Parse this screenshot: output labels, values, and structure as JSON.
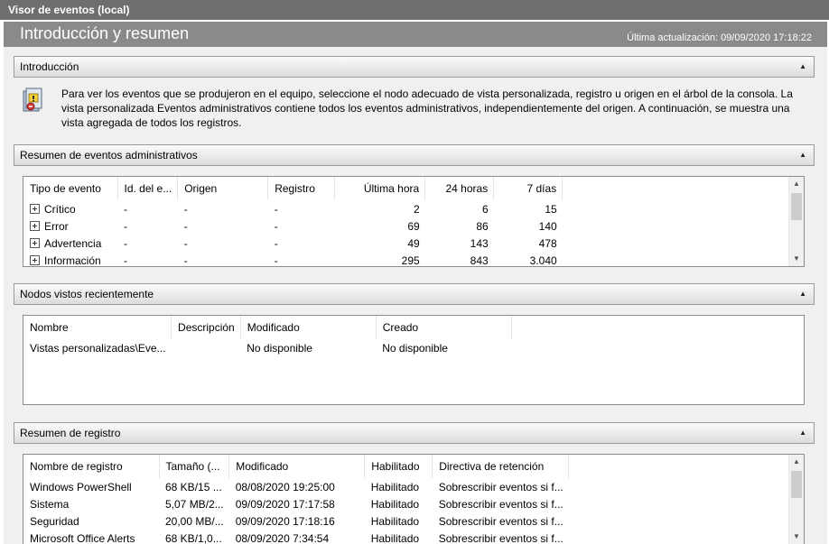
{
  "window_title": "Visor de eventos (local)",
  "page": {
    "title": "Introducción y resumen",
    "last_updated": "Última actualización: 09/09/2020 17:18:22"
  },
  "intro": {
    "header": "Introducción",
    "icon": "event-viewer-icon",
    "text": "Para ver los eventos que se produjeron en el equipo, seleccione el nodo adecuado de vista personalizada, registro u origen en el árbol de la consola. La vista personalizada Eventos administrativos contiene todos los eventos administrativos, independientemente del origen. A continuación, se muestra una vista agregada de todos los registros."
  },
  "admin_summary": {
    "header": "Resumen de eventos administrativos",
    "columns": [
      "Tipo de evento",
      "Id. del e...",
      "Origen",
      "Registro",
      "Última hora",
      "24 horas",
      "7 días"
    ],
    "rows": [
      [
        "Crítico",
        "-",
        "-",
        "-",
        "2",
        "6",
        "15"
      ],
      [
        "Error",
        "-",
        "-",
        "-",
        "69",
        "86",
        "140"
      ],
      [
        "Advertencia",
        "-",
        "-",
        "-",
        "49",
        "143",
        "478"
      ],
      [
        "Información",
        "-",
        "-",
        "-",
        "295",
        "843",
        "3.040"
      ]
    ]
  },
  "recent_nodes": {
    "header": "Nodos vistos recientemente",
    "columns": [
      "Nombre",
      "Descripción",
      "Modificado",
      "Creado"
    ],
    "rows": [
      [
        "Vistas personalizadas\\Eve...",
        "",
        "No disponible",
        "No disponible"
      ]
    ]
  },
  "log_summary": {
    "header": "Resumen de registro",
    "columns": [
      "Nombre de registro",
      "Tamaño (...",
      "Modificado",
      "Habilitado",
      "Directiva de retención"
    ],
    "rows": [
      [
        "Windows PowerShell",
        "68 KB/15 ...",
        "08/08/2020 19:25:00",
        "Habilitado",
        "Sobrescribir eventos si f..."
      ],
      [
        "Sistema",
        "5,07 MB/2...",
        "09/09/2020 17:17:58",
        "Habilitado",
        "Sobrescribir eventos si f..."
      ],
      [
        "Seguridad",
        "20,00 MB/...",
        "09/09/2020 17:18:16",
        "Habilitado",
        "Sobrescribir eventos si f..."
      ],
      [
        "Microsoft Office Alerts",
        "68 KB/1,0...",
        "08/09/2020 7:34:54",
        "Habilitado",
        "Sobrescribir eventos si f..."
      ]
    ]
  }
}
